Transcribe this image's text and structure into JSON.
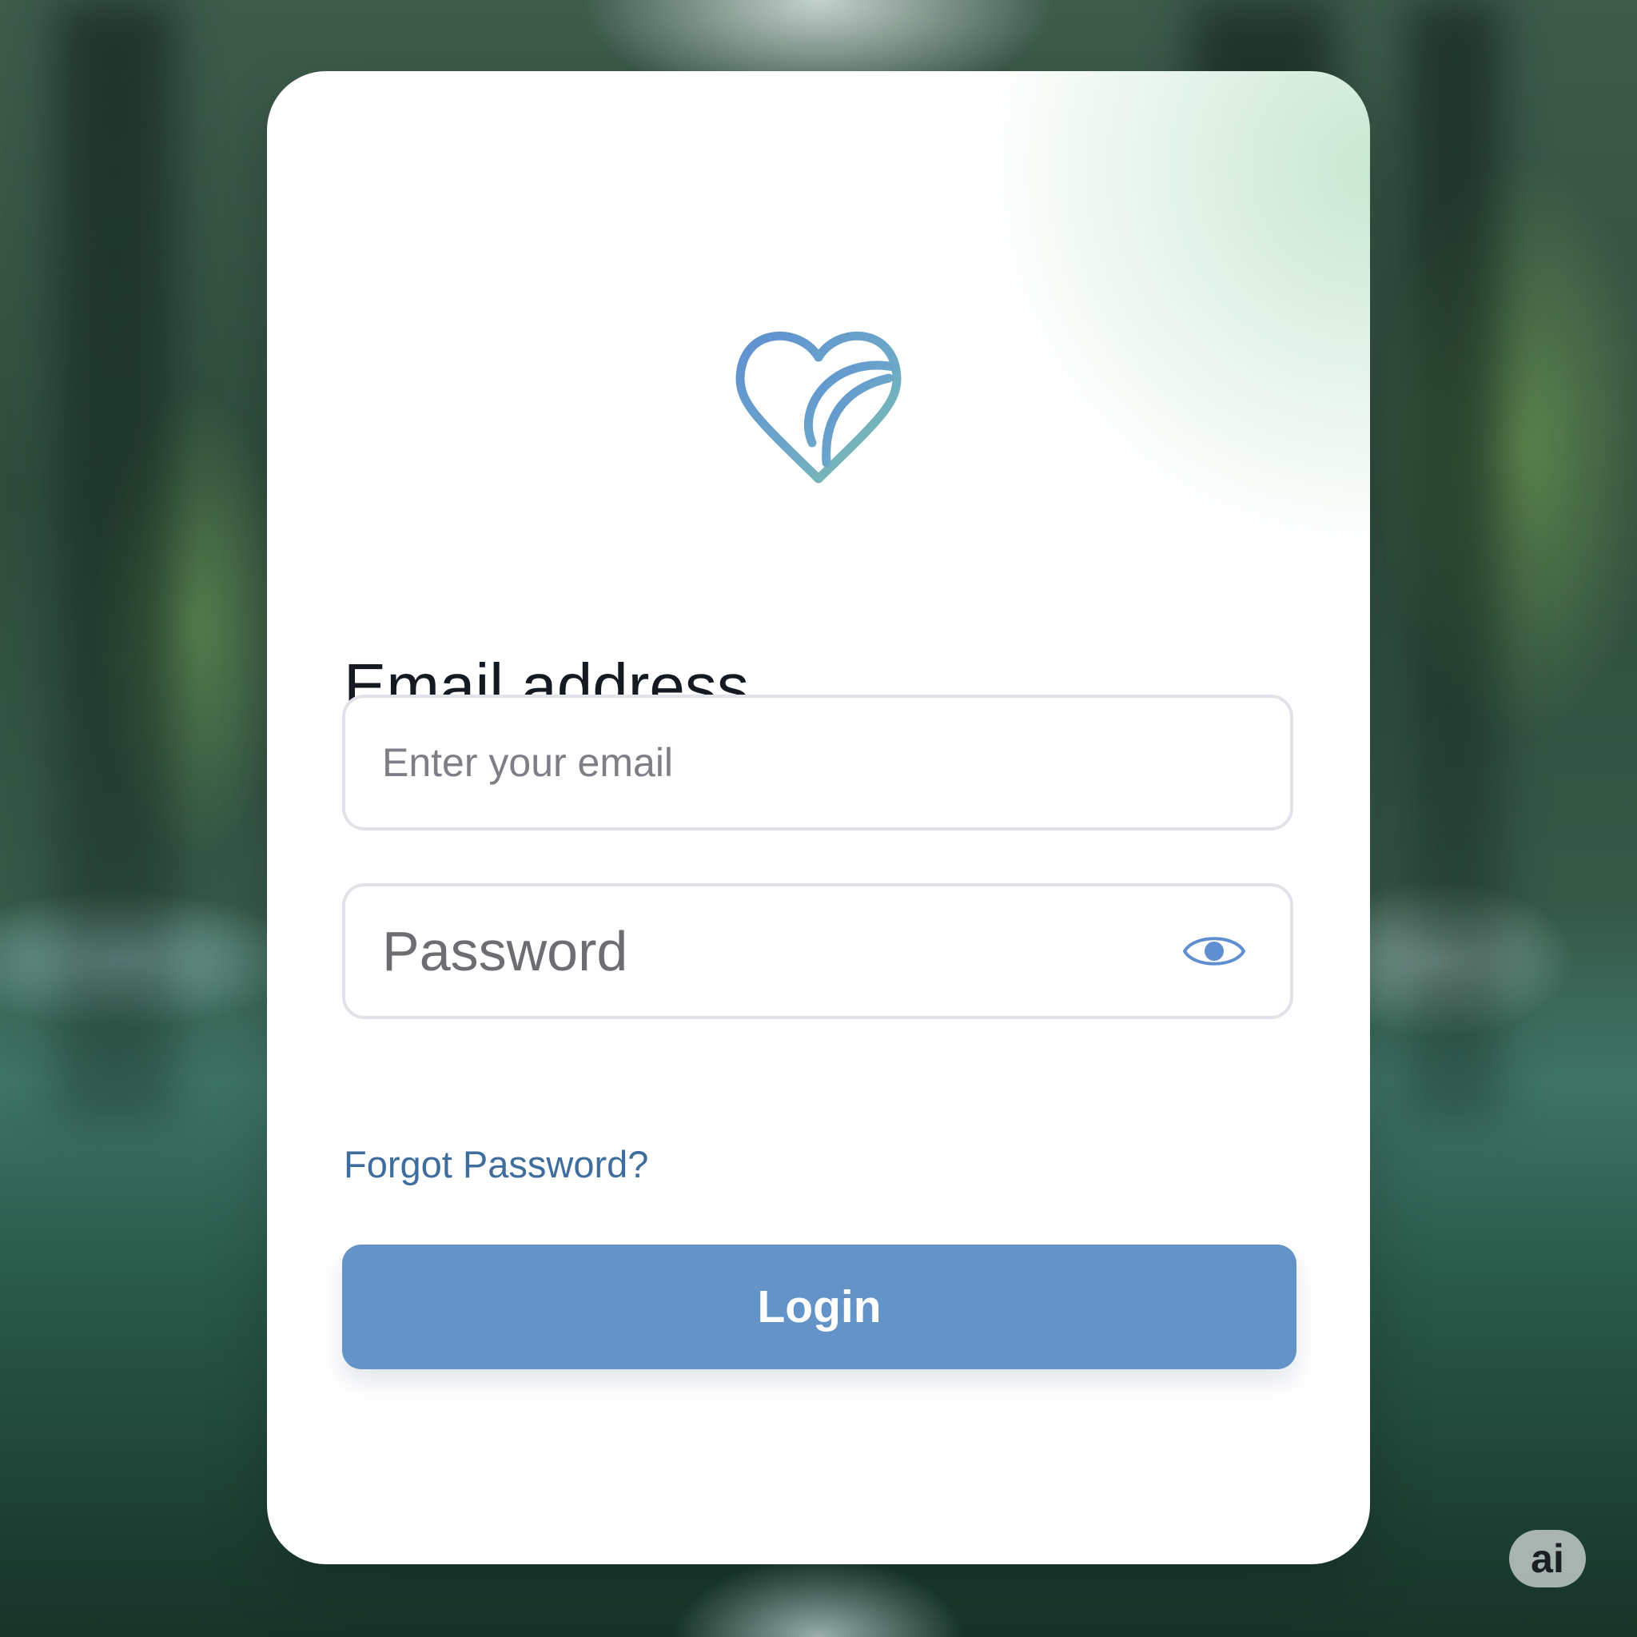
{
  "colors": {
    "accent": "#6494c7",
    "link": "#3f6d9d",
    "logo_blue": "#6495cf",
    "logo_green": "#7ec5a6",
    "title": "#151a22"
  },
  "logo": {
    "icon": "heart-leaf-icon"
  },
  "email": {
    "label": "Email address",
    "placeholder": "Enter your email"
  },
  "password": {
    "placeholder": "Password",
    "toggle_icon": "eye-icon"
  },
  "links": {
    "forgot": "Forgot Password?"
  },
  "actions": {
    "login": "Login"
  },
  "badge": {
    "text": "ai"
  }
}
